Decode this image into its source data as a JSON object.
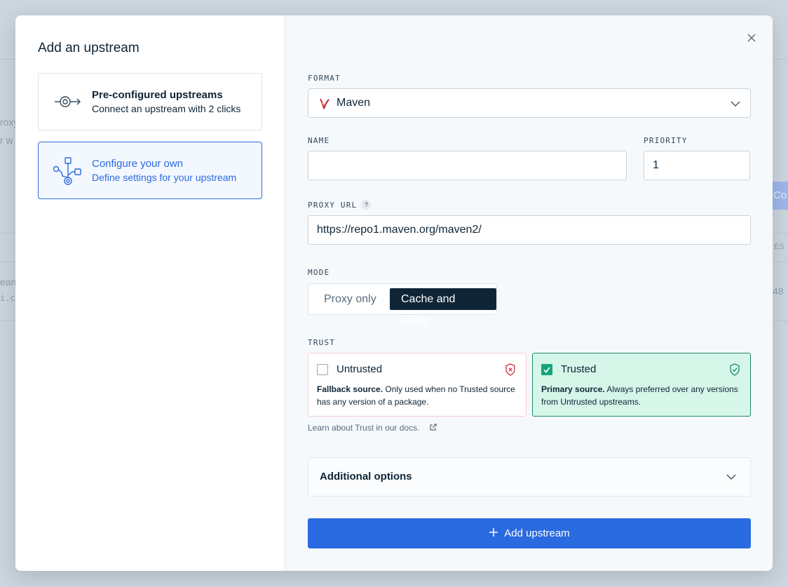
{
  "background": {
    "fragments": [
      "roxy",
      "r w",
      "eam",
      "i.c",
      "ES",
      "48"
    ],
    "button_fragment": "Co"
  },
  "modal": {
    "title": "Add an upstream",
    "options": [
      {
        "title": "Pre-configured upstreams",
        "subtitle": "Connect an upstream with 2 clicks",
        "icon": "preconfigured-icon",
        "selected": false
      },
      {
        "title": "Configure your own",
        "subtitle": "Define settings for your upstream",
        "icon": "configure-icon",
        "selected": true
      }
    ],
    "close_icon": "close-icon"
  },
  "form": {
    "format": {
      "label": "FORMAT",
      "value": "Maven",
      "icon": "maven-feather-icon"
    },
    "name": {
      "label": "NAME",
      "value": "",
      "placeholder": ""
    },
    "priority": {
      "label": "PRIORITY",
      "value": "1"
    },
    "proxy_url": {
      "label": "PROXY URL",
      "help": "?",
      "value": "https://repo1.maven.org/maven2/"
    },
    "mode": {
      "label": "MODE",
      "options": [
        "Proxy only",
        "Cache and proxy"
      ],
      "selected": "Cache and proxy"
    },
    "trust": {
      "label": "TRUST",
      "untrusted": {
        "title": "Untrusted",
        "lead": "Fallback source.",
        "desc": " Only used when no Trusted source has any version of a package.",
        "checked": false
      },
      "trusted": {
        "title": "Trusted",
        "lead": "Primary source.",
        "desc": " Always preferred over any versions from Untrusted upstreams.",
        "checked": true
      },
      "learn_link": "Learn about Trust in our docs."
    },
    "additional_options": "Additional options",
    "submit": "Add upstream"
  },
  "colors": {
    "accent": "#2a6ae0",
    "dark": "#0f2536",
    "trusted_bg": "#d5f6e8",
    "trusted_border": "#1e8a6c",
    "untrusted_border": "#f6cfd3",
    "danger": "#d0303c"
  }
}
